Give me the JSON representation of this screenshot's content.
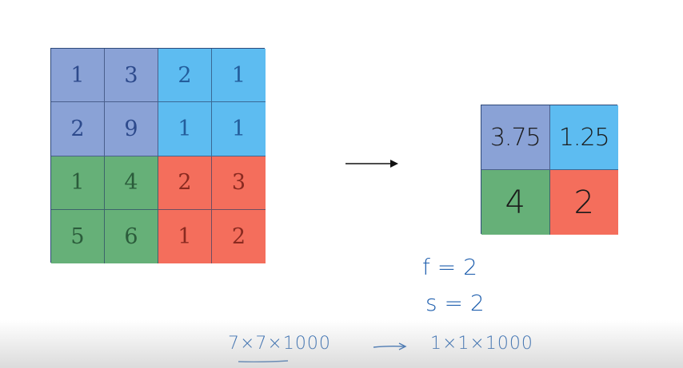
{
  "input_grid": {
    "cells": [
      {
        "value": "1",
        "color": "#8aa2d6"
      },
      {
        "value": "3",
        "color": "#8aa2d6"
      },
      {
        "value": "2",
        "color": "#5dbcf1"
      },
      {
        "value": "1",
        "color": "#5dbcf1"
      },
      {
        "value": "2",
        "color": "#8aa2d6"
      },
      {
        "value": "9",
        "color": "#8aa2d6"
      },
      {
        "value": "1",
        "color": "#5dbcf1"
      },
      {
        "value": "1",
        "color": "#5dbcf1"
      },
      {
        "value": "1",
        "color": "#66b078"
      },
      {
        "value": "4",
        "color": "#66b078"
      },
      {
        "value": "2",
        "color": "#f46e5c"
      },
      {
        "value": "3",
        "color": "#f46e5c"
      },
      {
        "value": "5",
        "color": "#66b078"
      },
      {
        "value": "6",
        "color": "#66b078"
      },
      {
        "value": "1",
        "color": "#f46e5c"
      },
      {
        "value": "2",
        "color": "#f46e5c"
      }
    ]
  },
  "output_grid": {
    "cells": [
      {
        "value": "3.75",
        "color": "#8aa2d6"
      },
      {
        "value": "1.25",
        "color": "#5dbcf1"
      },
      {
        "value": "4",
        "color": "#66b078"
      },
      {
        "value": "2",
        "color": "#f46e5c"
      }
    ]
  },
  "annotations": {
    "f": "f = 2",
    "s": "s = 2",
    "eq_left": "7×7×1000",
    "eq_right": "1×1×1000"
  },
  "colors": {
    "purple": "#8aa2d6",
    "blue": "#5dbcf1",
    "green": "#66b078",
    "red": "#f46e5c",
    "ink": "#1f5fae"
  }
}
